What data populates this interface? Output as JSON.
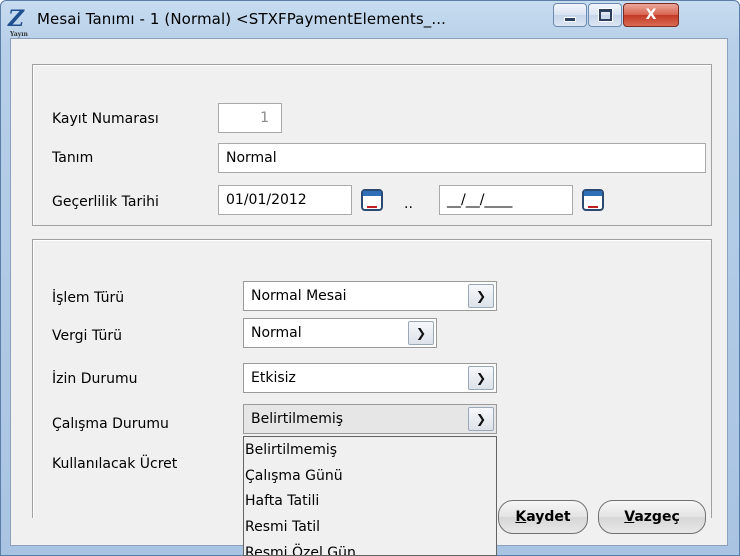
{
  "window": {
    "title": "Mesai Tanımı - 1 (Normal) <STXFPaymentElements_...",
    "close_glyph": "X",
    "icon_glyph": "Z",
    "icon_caption": "Yayın"
  },
  "form": {
    "record_no_label": "Kayıt Numarası",
    "record_no_value": "1",
    "name_label": "Tanım",
    "name_value": "Normal",
    "validity_label": "Geçerlilik Tarihi",
    "date_from": "01/01/2012",
    "date_sep": "..",
    "date_to": "__/__/____"
  },
  "details": {
    "process_type_label": "İşlem Türü",
    "process_type_value": "Normal Mesai",
    "tax_type_label": "Vergi Türü",
    "tax_type_value": "Normal",
    "leave_status_label": "İzin Durumu",
    "leave_status_value": "Etkisiz",
    "work_status_label": "Çalışma Durumu",
    "work_status_value": "Belirtilmemiş",
    "wage_label": "Kullanılacak Ücret"
  },
  "dropdown": {
    "items": [
      "Belirtilmemiş",
      "Çalışma Günü",
      "Hafta Tatili",
      "Resmi Tatil",
      "Resmi Özel Gün"
    ]
  },
  "buttons": {
    "save_hotkey": "K",
    "save_rest": "aydet",
    "cancel_hotkey": "V",
    "cancel_rest": "azgeç"
  }
}
